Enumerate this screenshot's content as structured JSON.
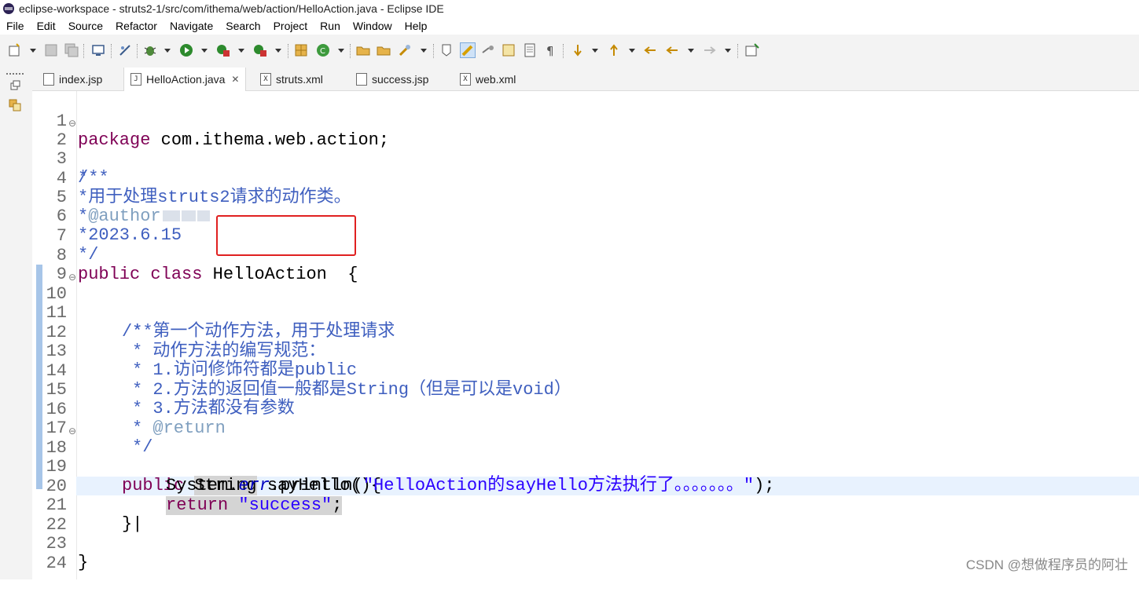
{
  "window": {
    "title": "eclipse-workspace - struts2-1/src/com/ithema/web/action/HelloAction.java - Eclipse IDE"
  },
  "menu": [
    "File",
    "Edit",
    "Source",
    "Refactor",
    "Navigate",
    "Search",
    "Project",
    "Run",
    "Window",
    "Help"
  ],
  "tabs": [
    {
      "label": "index.jsp",
      "icon": "jsp-file-icon",
      "active": false
    },
    {
      "label": "HelloAction.java",
      "icon": "java-file-icon",
      "active": true
    },
    {
      "label": "struts.xml",
      "icon": "xml-file-icon",
      "active": false
    },
    {
      "label": "success.jsp",
      "icon": "jsp-file-icon",
      "active": false
    },
    {
      "label": "web.xml",
      "icon": "xml-file-icon",
      "active": false
    }
  ],
  "editor": {
    "line_numbers": [
      "1",
      "2",
      "3",
      "4",
      "5",
      "6",
      "7",
      "8",
      "9",
      "10",
      "11",
      "12",
      "13",
      "14",
      "15",
      "16",
      "17",
      "18",
      "19",
      "20",
      "21",
      "22",
      "23",
      "24"
    ],
    "lines": {
      "l1_kw": "package",
      "l1_rest": " com.ithema.web.action;",
      "l2": "/**",
      "l3": "*",
      "l4": "*用于处理struts2请求的动作类。",
      "l5_a": "*",
      "l5_tag": "@author",
      "l6": "*2023.6.15",
      "l7": "*/",
      "l8_kw1": "public",
      "l8_kw2": "class",
      "l8_name": "HelloAction",
      "l8_brace": "{",
      "l10": "/**",
      "l11": "* 第一个动作方法，用于处理请求",
      "l12": "* 动作方法的编写规范：",
      "l13": "* 1.访问修饰符都是public",
      "l14": "* 2.方法的返回值一般都是String（但是可以是void）",
      "l15": "* 3.方法都没有参数",
      "l16_a": "* ",
      "l16_tag": "@return",
      "l17": "*/",
      "l18_kw": "public",
      "l18_type": "String",
      "l18_rest": " sayHello(){",
      "l19_a": "System.",
      "l19_field": "err",
      "l19_b": ".println(",
      "l19_str": "\"HelloAction的sayHello方法执行了。。。。。。。\"",
      "l19_c": ");",
      "l20_kw": "return",
      "l20_str": "\"success\"",
      "l20_c": ";",
      "l21": "}|",
      "l23": "}"
    }
  },
  "watermark": "CSDN @想做程序员的阿壮",
  "colors": {
    "keyword": "#7f0055",
    "comment": "#3f5fbf",
    "string": "#2a00ff",
    "annotation_box": "#e02020"
  }
}
